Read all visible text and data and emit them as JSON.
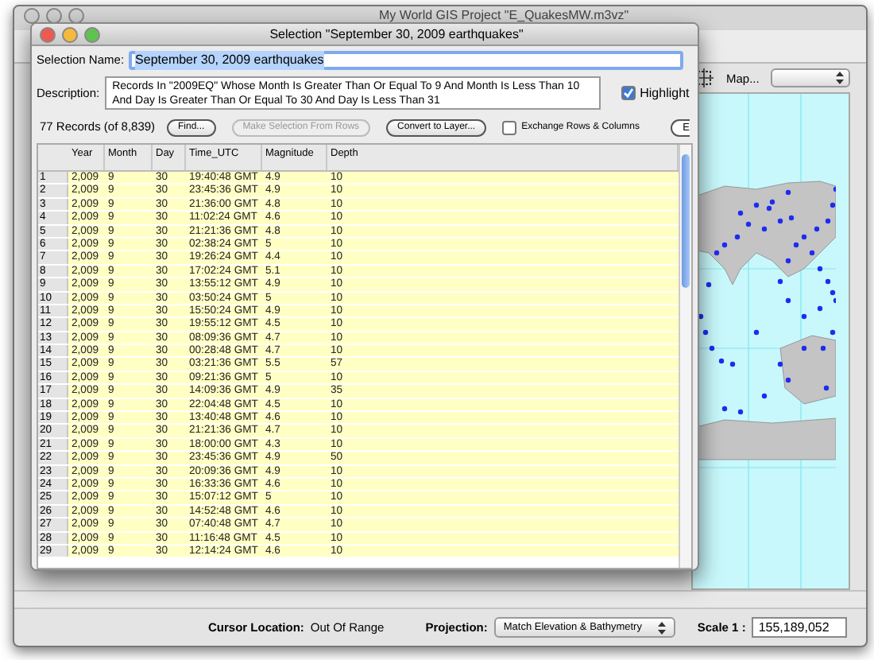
{
  "window": {
    "title": "My World GIS Project \"E_QuakesMW.m3vz\""
  },
  "dialog": {
    "title": "Selection \"September 30, 2009 earthquakes\"",
    "selection_name": {
      "label": "Selection Name:",
      "value": "September 30, 2009 earthquakes"
    },
    "description": {
      "label": "Description:",
      "value": "Records In \"2009EQ\" Whose Month Is Greater Than Or Equal To 9 And Month Is Less Than 10 And Day Is Greater Than Or Equal To 30 And Day Is Less Than 31"
    },
    "highlight": {
      "label": "Highlight",
      "checked": true
    },
    "record_count": "77 Records (of 8,839)",
    "buttons": [
      {
        "label": "Find...",
        "disabled": false
      },
      {
        "label": "Make Selection From Rows",
        "disabled": true
      },
      {
        "label": "Convert to Layer...",
        "disabled": false
      }
    ],
    "exchange": {
      "label": "Exchange Rows & Columns",
      "checked": false
    },
    "cut_button": "E",
    "table": {
      "columns": [
        "Year",
        "Month",
        "Day",
        "Time_UTC",
        "Magnitude",
        "Depth"
      ],
      "rows": [
        {
          "number": "1",
          "cells": [
            "2,009",
            "9",
            "30",
            "19:40:48 GMT",
            "4.9",
            "10"
          ]
        },
        {
          "number": "2",
          "cells": [
            "2,009",
            "9",
            "30",
            "23:45:36 GMT",
            "4.9",
            "10"
          ]
        },
        {
          "number": "3",
          "cells": [
            "2,009",
            "9",
            "30",
            "21:36:00 GMT",
            "4.8",
            "10"
          ]
        },
        {
          "number": "4",
          "cells": [
            "2,009",
            "9",
            "30",
            "11:02:24 GMT",
            "4.6",
            "10"
          ]
        },
        {
          "number": "5",
          "cells": [
            "2,009",
            "9",
            "30",
            "21:21:36 GMT",
            "4.8",
            "10"
          ]
        },
        {
          "number": "6",
          "cells": [
            "2,009",
            "9",
            "30",
            "02:38:24 GMT",
            "5",
            "10"
          ]
        },
        {
          "number": "7",
          "cells": [
            "2,009",
            "9",
            "30",
            "19:26:24 GMT",
            "4.4",
            "10"
          ]
        },
        {
          "number": "8",
          "cells": [
            "2,009",
            "9",
            "30",
            "17:02:24 GMT",
            "5.1",
            "10"
          ]
        },
        {
          "number": "9",
          "cells": [
            "2,009",
            "9",
            "30",
            "13:55:12 GMT",
            "4.9",
            "10"
          ]
        },
        {
          "number": "10",
          "cells": [
            "2,009",
            "9",
            "30",
            "03:50:24 GMT",
            "5",
            "10"
          ]
        },
        {
          "number": "11",
          "cells": [
            "2,009",
            "9",
            "30",
            "15:50:24 GMT",
            "4.9",
            "10"
          ]
        },
        {
          "number": "12",
          "cells": [
            "2,009",
            "9",
            "30",
            "19:55:12 GMT",
            "4.5",
            "10"
          ]
        },
        {
          "number": "13",
          "cells": [
            "2,009",
            "9",
            "30",
            "08:09:36 GMT",
            "4.7",
            "10"
          ]
        },
        {
          "number": "14",
          "cells": [
            "2,009",
            "9",
            "30",
            "00:28:48 GMT",
            "4.7",
            "10"
          ]
        },
        {
          "number": "15",
          "cells": [
            "2,009",
            "9",
            "30",
            "03:21:36 GMT",
            "5.5",
            "57"
          ]
        },
        {
          "number": "16",
          "cells": [
            "2,009",
            "9",
            "30",
            "09:21:36 GMT",
            "5",
            "10"
          ]
        },
        {
          "number": "17",
          "cells": [
            "2,009",
            "9",
            "30",
            "14:09:36 GMT",
            "4.9",
            "35"
          ]
        },
        {
          "number": "18",
          "cells": [
            "2,009",
            "9",
            "30",
            "22:04:48 GMT",
            "4.5",
            "10"
          ]
        },
        {
          "number": "19",
          "cells": [
            "2,009",
            "9",
            "30",
            "13:40:48 GMT",
            "4.6",
            "10"
          ]
        },
        {
          "number": "20",
          "cells": [
            "2,009",
            "9",
            "30",
            "21:21:36 GMT",
            "4.7",
            "10"
          ]
        },
        {
          "number": "21",
          "cells": [
            "2,009",
            "9",
            "30",
            "18:00:00 GMT",
            "4.3",
            "10"
          ]
        },
        {
          "number": "22",
          "cells": [
            "2,009",
            "9",
            "30",
            "23:45:36 GMT",
            "4.9",
            "50"
          ]
        },
        {
          "number": "23",
          "cells": [
            "2,009",
            "9",
            "30",
            "20:09:36 GMT",
            "4.9",
            "10"
          ]
        },
        {
          "number": "24",
          "cells": [
            "2,009",
            "9",
            "30",
            "16:33:36 GMT",
            "4.6",
            "10"
          ]
        },
        {
          "number": "25",
          "cells": [
            "2,009",
            "9",
            "30",
            "15:07:12 GMT",
            "5",
            "10"
          ]
        },
        {
          "number": "26",
          "cells": [
            "2,009",
            "9",
            "30",
            "14:52:48 GMT",
            "4.6",
            "10"
          ]
        },
        {
          "number": "27",
          "cells": [
            "2,009",
            "9",
            "30",
            "07:40:48 GMT",
            "4.7",
            "10"
          ]
        },
        {
          "number": "28",
          "cells": [
            "2,009",
            "9",
            "30",
            "11:16:48 GMT",
            "4.5",
            "10"
          ]
        },
        {
          "number": "29",
          "cells": [
            "2,009",
            "9",
            "30",
            "12:14:24 GMT",
            "4.6",
            "10"
          ]
        }
      ]
    }
  },
  "map_toolbar": {
    "label": "Map..."
  },
  "status_bar": {
    "cursor_label": "Cursor Location:",
    "cursor_value": "Out Of Range",
    "projection_label": "Projection:",
    "projection_value": "Match Elevation & Bathymetry",
    "scale_label": "Scale 1 :",
    "scale_value": "155,189,052"
  }
}
